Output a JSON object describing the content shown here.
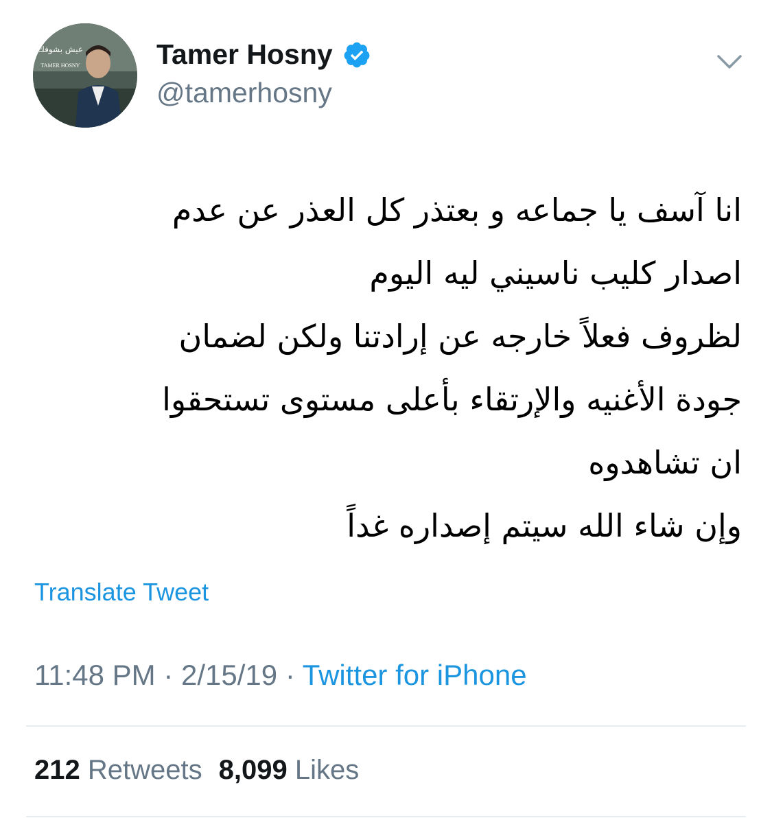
{
  "user": {
    "display_name": "Tamer Hosny",
    "handle": "@tamerhosny",
    "verified": true,
    "avatar_text_arabic": "عيش بشوفك",
    "avatar_text_latin": "TAMER HOSNY"
  },
  "tweet": {
    "lines": [
      "انا آسف يا جماعه و بعتذر كل العذر عن عدم",
      "اصدار كليب ناسيني ليه اليوم",
      "لظروف فعلاً خارجه عن إرادتنا ولكن لضمان",
      "جودة الأغنيه والإرتقاء بأعلى مستوى تستحقوا",
      "ان تشاهدوه",
      "وإن شاء الله سيتم إصداره غداً"
    ],
    "translate_label": "Translate Tweet"
  },
  "meta": {
    "time": "11:48 PM",
    "separator": "·",
    "date": "2/15/19",
    "source": "Twitter for iPhone"
  },
  "stats": {
    "retweets_count": "212",
    "retweets_label": "Retweets",
    "likes_count": "8,099",
    "likes_label": "Likes"
  },
  "colors": {
    "link": "#1b95e0",
    "secondary_text": "#657786",
    "primary_text": "#14171a",
    "divider": "#e6ecf0"
  },
  "icons": {
    "verified": "verified-badge-icon",
    "menu": "chevron-down-icon"
  }
}
